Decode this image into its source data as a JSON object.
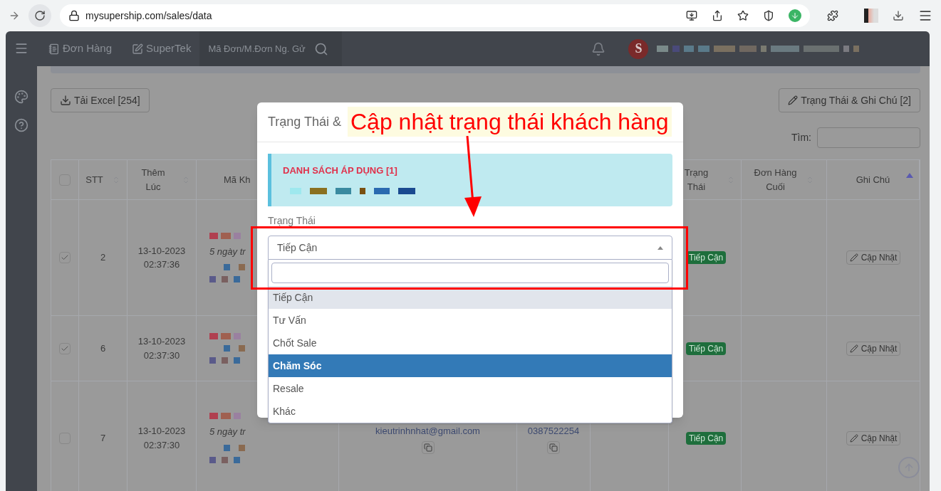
{
  "browser": {
    "url": "mysupership.com/sales/data"
  },
  "nav": {
    "items": [
      {
        "kind": "orders",
        "label": "Đơn Hàng"
      },
      {
        "kind": "edit",
        "label": "SuperTek"
      }
    ],
    "search_placeholder": "Mã Đơn/M.Đơn Ng. Gử",
    "avatar_letter": "S"
  },
  "toolbar": {
    "excel_button": "Tải Excel [254]",
    "status_button": "Trạng Thái & Ghi Chú [2]",
    "search_label": "Tìm:"
  },
  "table": {
    "columns": [
      {
        "label": "STT",
        "sortable": true
      },
      {
        "label": "Thêm Lúc",
        "sortable": true
      },
      {
        "label": "Mã Kh",
        "sortable": false
      },
      {
        "label": "Trạng Thái",
        "sortable": true
      },
      {
        "label": "Đơn Hàng Cuối",
        "sortable": true
      },
      {
        "label": "Ghi Chú",
        "sortable": true
      }
    ],
    "all_checked": false,
    "rows": [
      {
        "checked": true,
        "stt": "2",
        "added": [
          "13-10-2023",
          "02:37:36"
        ],
        "hint": "5 ngày tr",
        "status": "Tiếp Cận",
        "note_button": "Cập Nhật"
      },
      {
        "checked": true,
        "stt": "6",
        "added": [
          "13-10-2023",
          "02:37:30"
        ],
        "status": "Tiếp Cận",
        "note_button": "Cập Nhật"
      },
      {
        "checked": false,
        "stt": "7",
        "added": [
          "13-10-2023",
          "02:37:30"
        ],
        "hint": "5 ngày tr",
        "email": "kieutrinhnhat@gmail.com",
        "phone": "0387522254",
        "status": "Tiếp Cận",
        "note_button": "Cập Nhật"
      }
    ]
  },
  "modal": {
    "title": "Trạng Thái &",
    "info_title": "DANH SÁCH ÁP DỤNG [1]",
    "field_label": "Trạng Thái",
    "value": "Tiếp Cận",
    "options": [
      {
        "label": "Tiếp Cận",
        "selected": true,
        "highlighted": false
      },
      {
        "label": "Tư Vấn",
        "selected": false,
        "highlighted": false
      },
      {
        "label": "Chốt Sale",
        "selected": false,
        "highlighted": false
      },
      {
        "label": "Chăm Sóc",
        "selected": false,
        "highlighted": true
      },
      {
        "label": "Resale",
        "selected": false,
        "highlighted": false
      },
      {
        "label": "Khác",
        "selected": false,
        "highlighted": false
      }
    ]
  },
  "annotation": {
    "text": "Cập nhật trạng thái khách hàng"
  }
}
